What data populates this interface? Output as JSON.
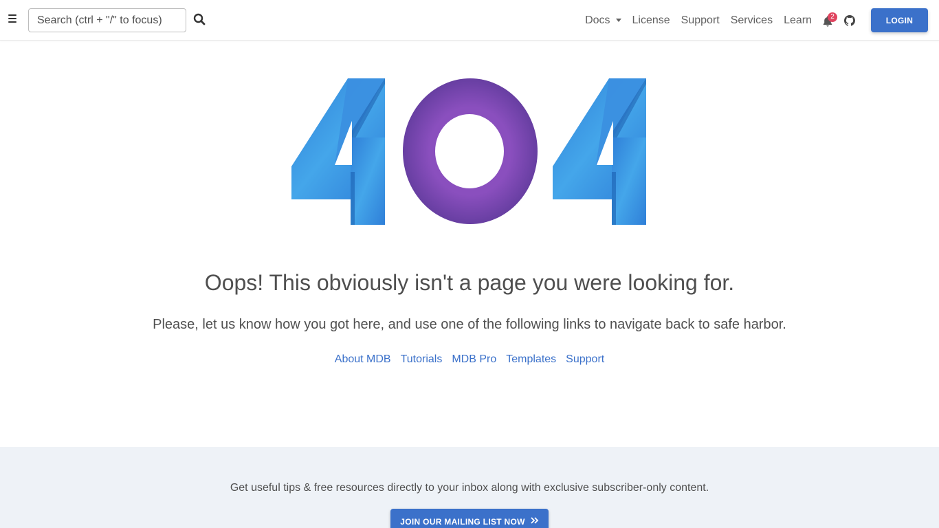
{
  "navbar": {
    "menu_icon": "hamburger-icon",
    "search": {
      "placeholder": "Search (ctrl + \"/\" to focus)",
      "value": ""
    },
    "search_icon": "search-icon",
    "links": {
      "docs": "Docs",
      "license": "License",
      "support": "Support",
      "services": "Services",
      "learn": "Learn"
    },
    "notifications": {
      "icon": "bell-icon",
      "count": "2",
      "badge_color": "#e0445f"
    },
    "github_icon": "github-icon",
    "login_label": "LOGIN"
  },
  "hero": {
    "graphic": "404",
    "headline": "Oops! This obviously isn't a page you were looking for.",
    "subline": "Please, let us know how you got here, and use one of the following links to navigate back to safe harbor.",
    "links": [
      "About MDB",
      "Tutorials",
      "MDB Pro",
      "Templates",
      "Support"
    ]
  },
  "footer": {
    "text": "Get useful tips & free resources directly to your inbox along with exclusive subscriber-only content.",
    "button_label": "JOIN OUR MAILING LIST NOW",
    "button_icon": "double-chevron-right-icon"
  },
  "colors": {
    "primary": "#3b71ca",
    "digit_blue": "#3b8fe0",
    "digit_purple": "#6f42a8",
    "footer_bg": "#eef2f7"
  }
}
